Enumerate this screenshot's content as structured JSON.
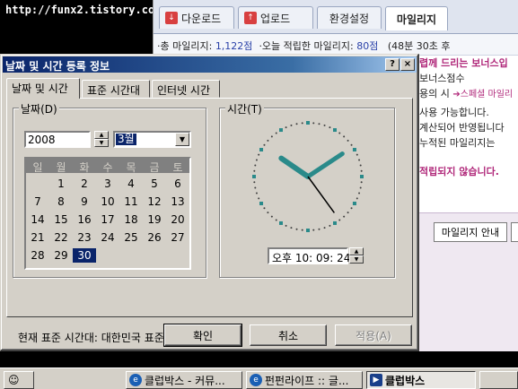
{
  "watermark": "http://funx2.tistory.com",
  "background_page": {
    "tabs": [
      {
        "label": "다운로드",
        "icon": "download-icon",
        "color": "#d84040"
      },
      {
        "label": "업로드",
        "icon": "upload-icon",
        "color": "#d84040"
      },
      {
        "label": "환경설정",
        "icon": "",
        "color": ""
      },
      {
        "label": "마일리지",
        "icon": "",
        "color": ""
      }
    ],
    "stats": {
      "total_label": "·총 마일리지:",
      "total_value": "1,122점",
      "today_label": "·오늘 적립한 마일리지:",
      "today_value": "80점",
      "timer": "(48분 30초 후"
    },
    "content_lines": {
      "l1": "렵께 드리는 보너스입",
      "l2": "보너스점수",
      "l3": "용의 시",
      "l3_link": "➔스페셜 마일리",
      "l4": "사용 가능합니다.",
      "l5": "계산되어 반영됩니다",
      "l6": "누적된 마일리지는",
      "l7": "적립되지 않습니다."
    },
    "buttons": {
      "mileage_info": "마일리지 안내"
    }
  },
  "dialog": {
    "title": "날짜 및 시간 등록 정보",
    "help_button": "?",
    "close_button": "×",
    "tabs": [
      "날짜 및 시간",
      "표준 시간대",
      "인터넷 시간"
    ],
    "date_group": {
      "title": "날짜(D)",
      "year": "2008",
      "month": "3월",
      "weekdays": [
        "일",
        "월",
        "화",
        "수",
        "목",
        "금",
        "토"
      ],
      "days": [
        [
          "",
          "1",
          "2",
          "3",
          "4",
          "5",
          "6"
        ],
        [
          "7",
          "8",
          "9",
          "10",
          "11",
          "12",
          "13"
        ],
        [
          "14",
          "15",
          "16",
          "17",
          "18",
          "19",
          "20"
        ],
        [
          "21",
          "22",
          "23",
          "24",
          "25",
          "26",
          "27"
        ],
        [
          "28",
          "29",
          "30",
          "",
          "",
          "",
          ""
        ]
      ],
      "selected_day": "30"
    },
    "time_group": {
      "title": "시간(T)",
      "time_text": "오후 10: 09: 24",
      "hour": 22,
      "minute": 9,
      "second": 24
    },
    "timezone_text": "현재 표준 시간대: 대한민국 표준시",
    "buttons": {
      "ok": "확인",
      "cancel": "취소",
      "apply": "적용(A)"
    }
  },
  "taskbar": {
    "tasks": [
      {
        "label": "클럽박스 - 커뮤...",
        "active": false
      },
      {
        "label": "펀펀라이프 :: 글...",
        "active": false
      },
      {
        "label": "클럽박스",
        "active": true
      }
    ]
  },
  "colors": {
    "titlebar": "#0a246a",
    "selection": "#0a246a",
    "clock_hand": "#2a8a8a",
    "accent_pink": "#b0287a"
  }
}
